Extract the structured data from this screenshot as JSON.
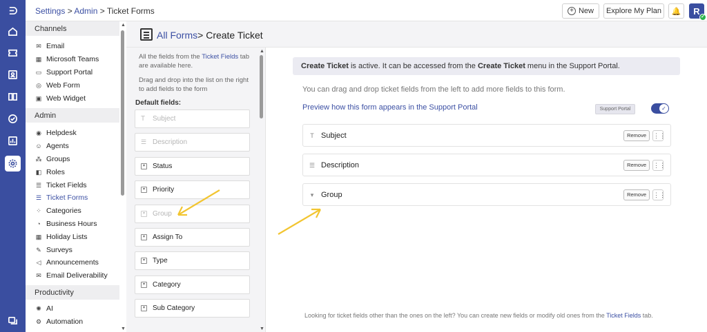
{
  "breadcrumb": {
    "settings": "Settings",
    "sep1": " > ",
    "admin": "Admin",
    "sep2": " > ",
    "current": "Ticket Forms"
  },
  "topbar": {
    "new_label": "New",
    "plan_label": "Explore My Plan",
    "avatar": "R"
  },
  "sidebar": {
    "channels_header": "Channels",
    "channels": [
      {
        "label": "Email",
        "icon": "mail-icon"
      },
      {
        "label": "Microsoft Teams",
        "icon": "teams-icon"
      },
      {
        "label": "Support Portal",
        "icon": "portal-icon"
      },
      {
        "label": "Web Form",
        "icon": "globe-icon"
      },
      {
        "label": "Web Widget",
        "icon": "widget-icon"
      }
    ],
    "admin_header": "Admin",
    "admin": [
      {
        "label": "Helpdesk",
        "icon": "helpdesk-icon"
      },
      {
        "label": "Agents",
        "icon": "agent-icon"
      },
      {
        "label": "Groups",
        "icon": "groups-icon"
      },
      {
        "label": "Roles",
        "icon": "roles-icon"
      },
      {
        "label": "Ticket Fields",
        "icon": "fields-icon"
      },
      {
        "label": "Ticket Forms",
        "icon": "forms-icon",
        "active": true
      },
      {
        "label": "Categories",
        "icon": "categories-icon"
      },
      {
        "label": "Business Hours",
        "icon": "clock-icon"
      },
      {
        "label": "Holiday Lists",
        "icon": "calendar-icon"
      },
      {
        "label": "Surveys",
        "icon": "survey-icon"
      },
      {
        "label": "Announcements",
        "icon": "megaphone-icon"
      },
      {
        "label": "Email Deliverability",
        "icon": "mail-check-icon"
      }
    ],
    "productivity_header": "Productivity",
    "productivity": [
      {
        "label": "AI",
        "icon": "ai-icon"
      },
      {
        "label": "Automation",
        "icon": "automation-icon"
      }
    ]
  },
  "header": {
    "all_forms": "All Forms",
    "sep": ">",
    "title": " Create Ticket"
  },
  "mid": {
    "note1_a": "All the fields from the ",
    "note1_link": "Ticket Fields",
    "note1_b": " tab are available here.",
    "note2": "Drag and drop into the list on the right to add fields to the form",
    "default_label": "Default fields:",
    "fields": [
      {
        "label": "Subject",
        "disabled": true
      },
      {
        "label": "Description",
        "disabled": true
      },
      {
        "label": "Status",
        "disabled": false
      },
      {
        "label": "Priority",
        "disabled": false
      },
      {
        "label": "Group",
        "disabled": true
      },
      {
        "label": "Assign To",
        "disabled": false
      },
      {
        "label": "Type",
        "disabled": false
      },
      {
        "label": "Category",
        "disabled": false
      },
      {
        "label": "Sub Category",
        "disabled": false
      }
    ]
  },
  "right": {
    "banner_b1": "Create Ticket",
    "banner_t1": " is active. It can be accessed from the ",
    "banner_b2": "Create Ticket",
    "banner_t2": " menu in the Support Portal.",
    "info": "You can drag and drop ticket fields from the left to add more fields to this form.",
    "preview_link": "Preview how this form appears in the Support Portal",
    "portal_tag": "Support Portal",
    "toggle_on": true,
    "form_fields": [
      "Subject",
      "Description",
      "Group"
    ],
    "remove_label": "Remove",
    "footer_a": "Looking for ticket fields other than the ones on the left? You can create new fields or modify old ones from the ",
    "footer_link": "Ticket Fields",
    "footer_b": " tab."
  },
  "colors": {
    "brand": "#3a4ea0",
    "link": "#3b4fa3",
    "annotation_arrow": "#f2c531"
  }
}
